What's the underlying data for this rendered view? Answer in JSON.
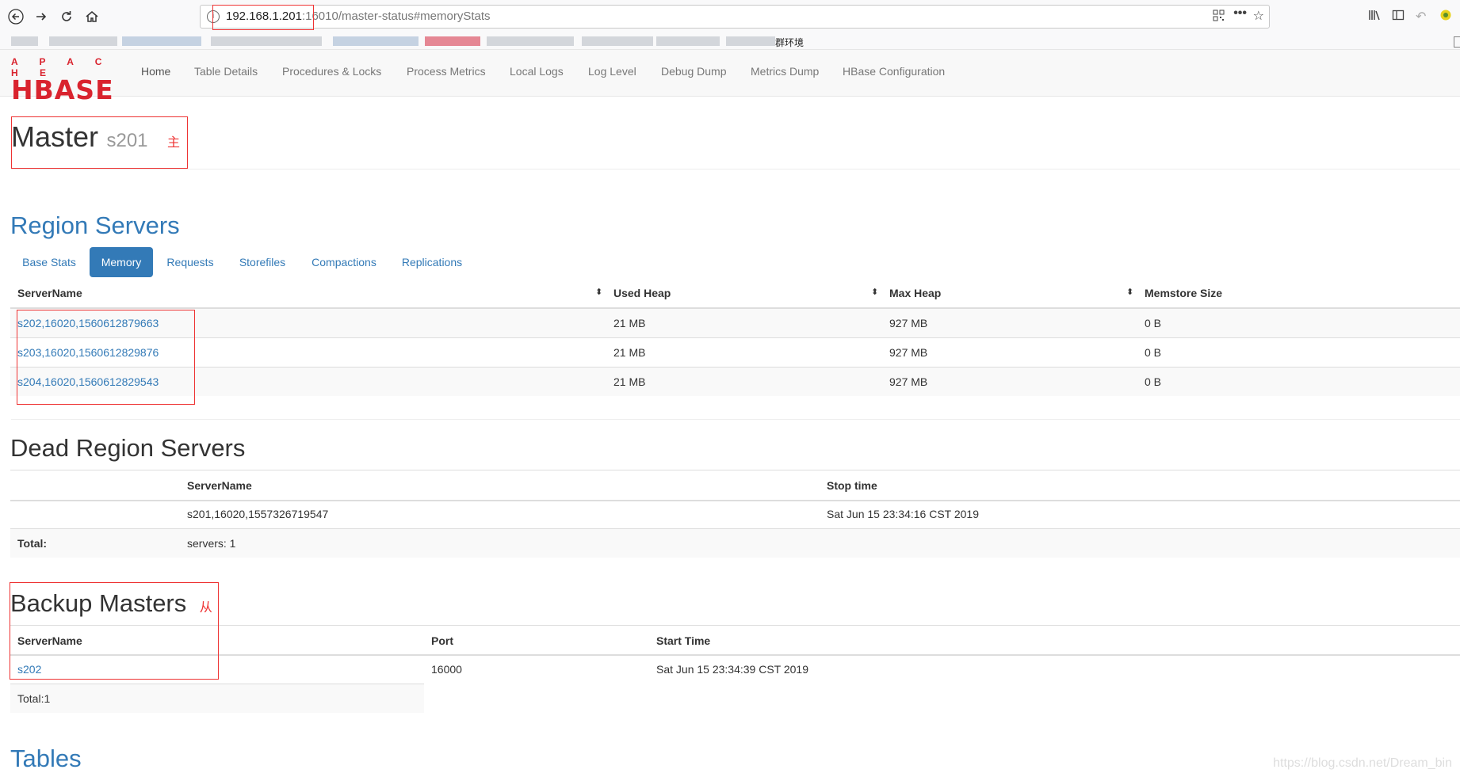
{
  "browser": {
    "url_host": "192.168.1.201",
    "url_port": ":16010/",
    "url_path": "master-status#memoryStats",
    "bookmark_visible": "群环境"
  },
  "navbar": {
    "logo_top": "A P A C H E",
    "logo_bottom": "HBASE",
    "items": [
      {
        "label": "Home"
      },
      {
        "label": "Table Details"
      },
      {
        "label": "Procedures & Locks"
      },
      {
        "label": "Process Metrics"
      },
      {
        "label": "Local Logs"
      },
      {
        "label": "Log Level"
      },
      {
        "label": "Debug Dump"
      },
      {
        "label": "Metrics Dump"
      },
      {
        "label": "HBase Configuration"
      }
    ]
  },
  "master": {
    "title": "Master",
    "hostname": "s201",
    "annotation": "主"
  },
  "region_servers": {
    "title": "Region Servers",
    "tabs": [
      {
        "label": "Base Stats",
        "active": false
      },
      {
        "label": "Memory",
        "active": true
      },
      {
        "label": "Requests",
        "active": false
      },
      {
        "label": "Storefiles",
        "active": false
      },
      {
        "label": "Compactions",
        "active": false
      },
      {
        "label": "Replications",
        "active": false
      }
    ],
    "columns": [
      "ServerName",
      "Used Heap",
      "Max Heap",
      "Memstore Size"
    ],
    "rows": [
      {
        "server": "s202,16020,1560612879663",
        "used_heap": "21 MB",
        "max_heap": "927 MB",
        "memstore": "0 B"
      },
      {
        "server": "s203,16020,1560612829876",
        "used_heap": "21 MB",
        "max_heap": "927 MB",
        "memstore": "0 B"
      },
      {
        "server": "s204,16020,1560612829543",
        "used_heap": "21 MB",
        "max_heap": "927 MB",
        "memstore": "0 B"
      }
    ]
  },
  "dead_region_servers": {
    "title": "Dead Region Servers",
    "columns": [
      "ServerName",
      "Stop time"
    ],
    "rows": [
      {
        "server": "s201,16020,1557326719547",
        "stop_time": "Sat Jun 15 23:34:16 CST 2019"
      }
    ],
    "total_label": "Total:",
    "total_value": "servers: 1"
  },
  "backup_masters": {
    "title": "Backup Masters",
    "annotation": "从",
    "columns": [
      "ServerName",
      "Port",
      "Start Time"
    ],
    "rows": [
      {
        "server": "s202",
        "port": "16000",
        "start_time": "Sat Jun 15 23:34:39 CST 2019"
      }
    ],
    "total": "Total:1"
  },
  "tables": {
    "title": "Tables"
  },
  "watermark": "https://blog.csdn.net/Dream_bin",
  "colors": {
    "link": "#337ab7",
    "annotation_red": "#e33333",
    "hbase_red": "#d9232e"
  }
}
